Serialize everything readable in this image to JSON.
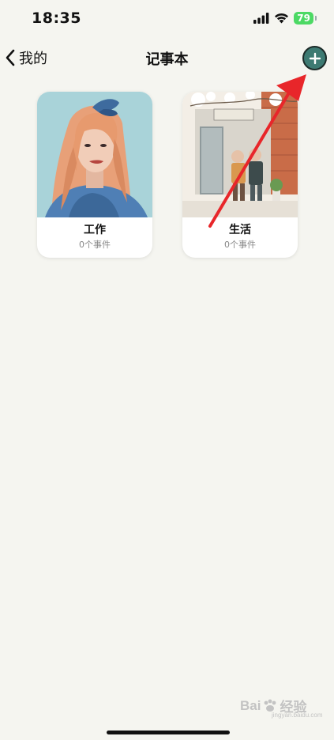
{
  "status_bar": {
    "time": "18:35",
    "battery": "79",
    "icons": [
      "signal-icon",
      "wifi-icon",
      "battery-icon"
    ]
  },
  "nav": {
    "back_label": "我的",
    "title": "记事本"
  },
  "notebooks": [
    {
      "title": "工作",
      "subtitle": "0个事件",
      "cover": "woman-portrait-illustration"
    },
    {
      "title": "生活",
      "subtitle": "0个事件",
      "cover": "couple-shopfront-illustration"
    }
  ],
  "annotation": {
    "type": "red-arrow",
    "color": "#e8262a"
  },
  "watermark": {
    "brand": "Bai",
    "brand_rest": "经验",
    "sub": "jingyan.baidu.com"
  },
  "colors": {
    "background": "#f5f5f0",
    "accent": "#3d7a72",
    "battery": "#4cd964"
  }
}
